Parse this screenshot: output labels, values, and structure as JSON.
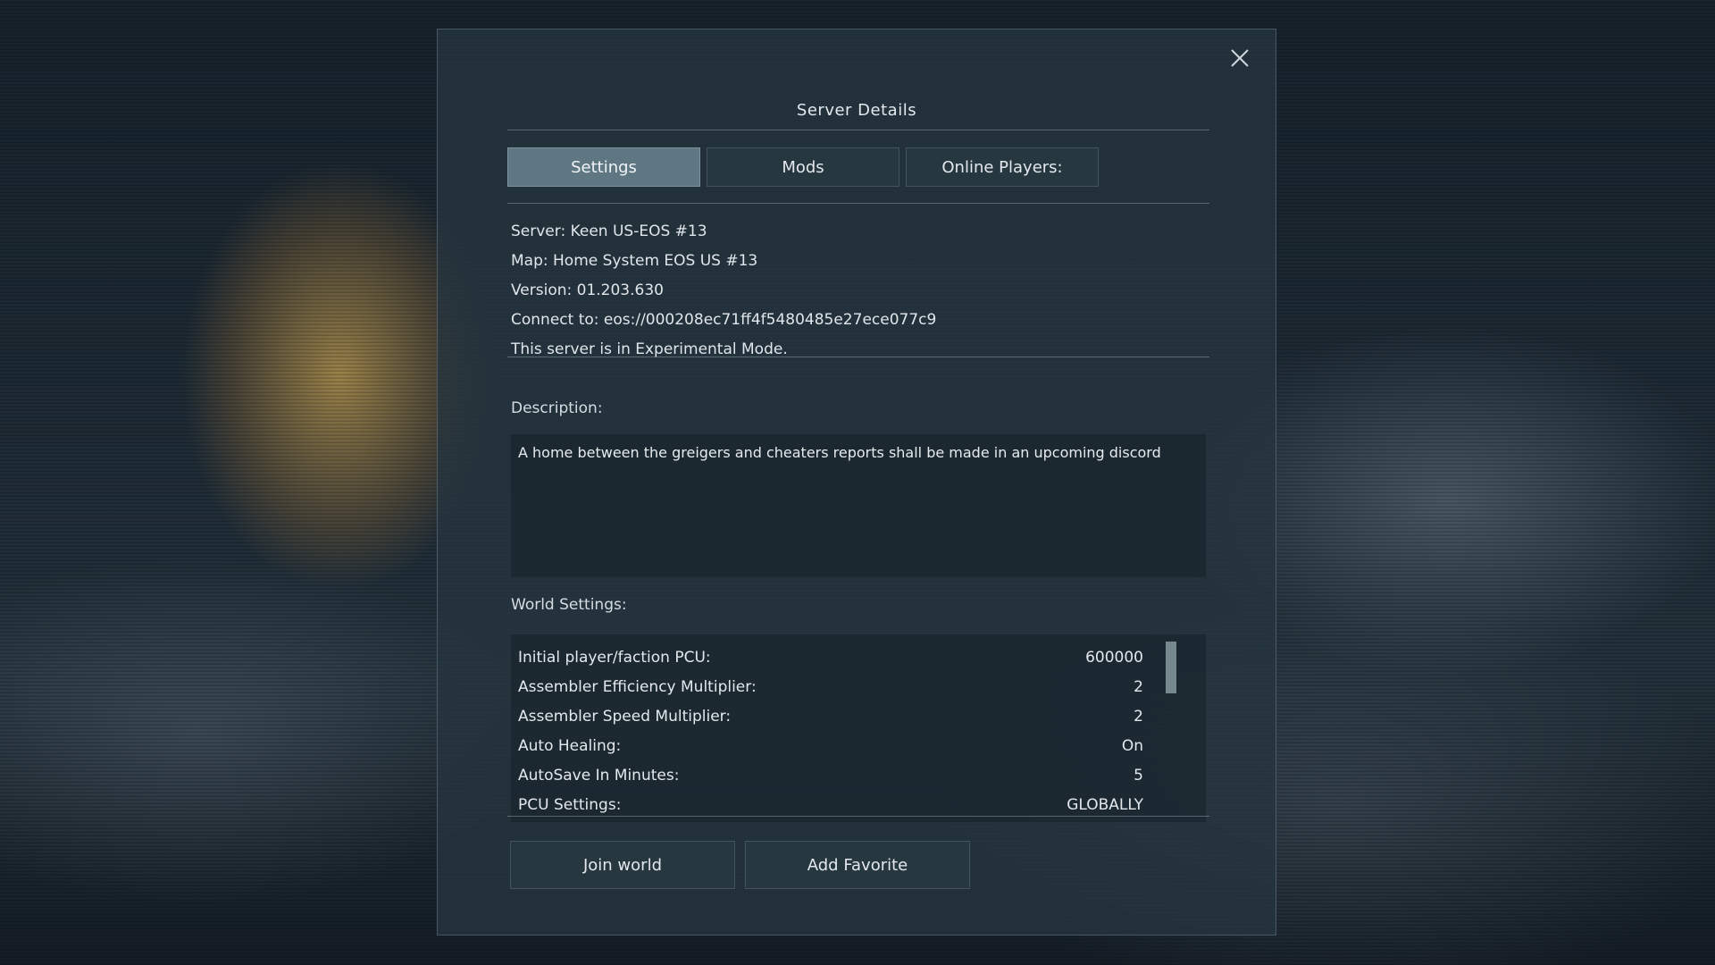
{
  "dialog": {
    "title": "Server Details",
    "close_icon": "close-icon"
  },
  "tabs": [
    {
      "label": "Settings",
      "active": true
    },
    {
      "label": "Mods",
      "active": false
    },
    {
      "label": "Online Players:",
      "active": false
    }
  ],
  "server_info": {
    "server": "Server: Keen US-EOS #13",
    "map": "Map: Home System EOS US #13",
    "version": "Version: 01.203.630",
    "connect": "Connect to: eos://000208ec71ff4f5480485e27ece077c9",
    "mode": "This server is in Experimental Mode."
  },
  "description": {
    "label": "Description:",
    "text": "A home between the greigers and cheaters reports shall be made in an upcoming discord"
  },
  "world_settings": {
    "label": "World Settings:",
    "rows": [
      {
        "key": "Initial player/faction PCU:",
        "value": "600000"
      },
      {
        "key": "Assembler Efficiency Multiplier:",
        "value": "2"
      },
      {
        "key": "Assembler Speed Multiplier:",
        "value": "2"
      },
      {
        "key": "Auto Healing:",
        "value": "On"
      },
      {
        "key": "AutoSave In Minutes:",
        "value": "5"
      },
      {
        "key": "PCU Settings:",
        "value": "GLOBALLY"
      }
    ]
  },
  "buttons": {
    "join": "Join world",
    "favorite": "Add Favorite"
  },
  "colors": {
    "active_tab": "#5f7782",
    "panel": "#26343e"
  }
}
